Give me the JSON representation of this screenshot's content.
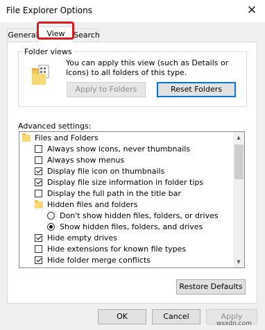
{
  "window": {
    "title": "File Explorer Options"
  },
  "tabs": [
    {
      "label": "General"
    },
    {
      "label": "View",
      "active": true
    },
    {
      "label": "Search"
    }
  ],
  "folder_views": {
    "label": "Folder views",
    "description": "You can apply this view (such as Details or Icons) to all folders of this type.",
    "apply_button": "Apply to Folders",
    "reset_button": "Reset Folders"
  },
  "advanced": {
    "label": "Advanced settings:",
    "items": [
      {
        "type": "folder",
        "label": "Files and Folders",
        "indent": 0
      },
      {
        "type": "checkbox",
        "label": "Always show icons, never thumbnails",
        "checked": false,
        "indent": 1
      },
      {
        "type": "checkbox",
        "label": "Always show menus",
        "checked": false,
        "indent": 1
      },
      {
        "type": "checkbox",
        "label": "Display file icon on thumbnails",
        "checked": true,
        "indent": 1
      },
      {
        "type": "checkbox",
        "label": "Display file size information in folder tips",
        "checked": true,
        "indent": 1
      },
      {
        "type": "checkbox",
        "label": "Display the full path in the title bar",
        "checked": false,
        "indent": 1
      },
      {
        "type": "folder",
        "label": "Hidden files and folders",
        "indent": 1
      },
      {
        "type": "radio",
        "label": "Don't show hidden files, folders, or drives",
        "checked": false,
        "indent": 2
      },
      {
        "type": "radio",
        "label": "Show hidden files, folders, and drives",
        "checked": true,
        "indent": 2
      },
      {
        "type": "checkbox",
        "label": "Hide empty drives",
        "checked": true,
        "indent": 1
      },
      {
        "type": "checkbox",
        "label": "Hide extensions for known file types",
        "checked": false,
        "indent": 1
      },
      {
        "type": "checkbox",
        "label": "Hide folder merge conflicts",
        "checked": true,
        "indent": 1
      }
    ]
  },
  "buttons": {
    "restore": "Restore Defaults",
    "ok": "OK",
    "cancel": "Cancel",
    "apply": "Apply"
  },
  "watermark": "wsxdn.com",
  "colors": {
    "highlight": "#d7181e",
    "accent": "#0078d7",
    "folder": "#f8d775"
  }
}
